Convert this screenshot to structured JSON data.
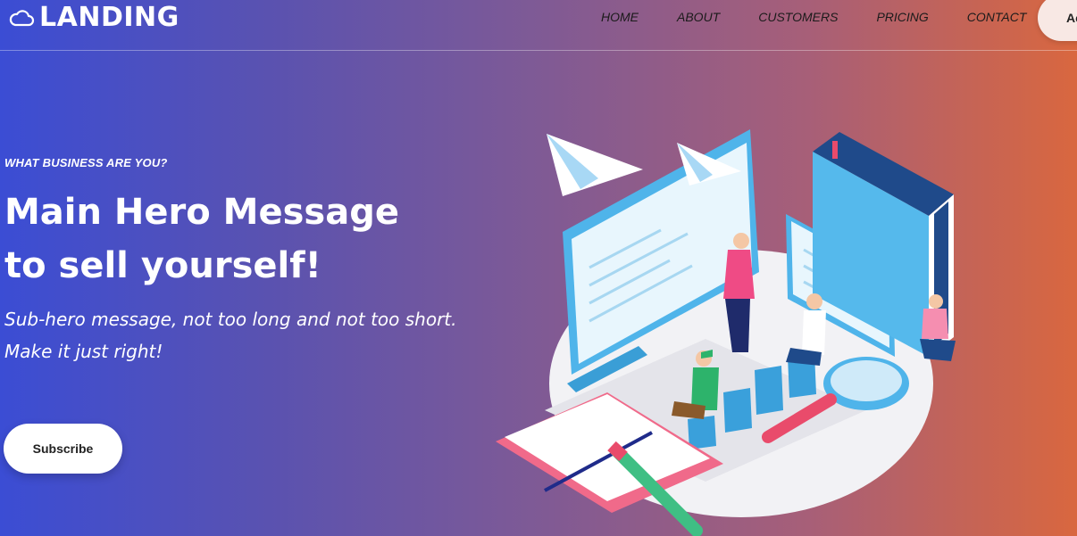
{
  "brand": {
    "name": "LANDING",
    "icon": "cloud-icon"
  },
  "nav": {
    "items": [
      {
        "label": "HOME"
      },
      {
        "label": "ABOUT"
      },
      {
        "label": "CUSTOMERS"
      },
      {
        "label": "PRICING"
      },
      {
        "label": "CONTACT"
      }
    ],
    "action_label": "Ac"
  },
  "hero": {
    "eyebrow": "WHAT BUSINESS ARE YOU?",
    "headline": "Main Hero Message to sell yourself!",
    "subheadline": "Sub-hero message, not too long and not too short. Make it just right!",
    "cta_label": "Subscribe"
  },
  "colors": {
    "gradient_start": "#3b4dd4",
    "gradient_end": "#d9673f",
    "button_bg": "#ffffff"
  }
}
